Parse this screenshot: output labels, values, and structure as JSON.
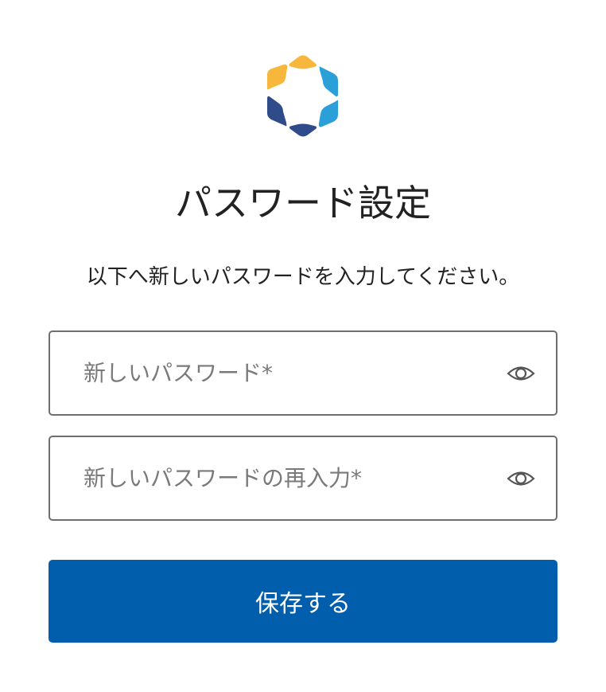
{
  "logo": {
    "colors": {
      "yellow": "#f6b73c",
      "light_blue": "#2b9fd8",
      "dark_blue": "#2f4b8a"
    }
  },
  "title": "パスワード設定",
  "subtitle": "以下へ新しいパスワードを入力してください。",
  "fields": {
    "new_password": {
      "value": "",
      "placeholder": "新しいパスワード*",
      "toggle_icon": "eye-icon"
    },
    "confirm_password": {
      "value": "",
      "placeholder": "新しいパスワードの再入力*",
      "toggle_icon": "eye-icon"
    }
  },
  "save_button": {
    "label": "保存する",
    "color": "#005eac"
  }
}
